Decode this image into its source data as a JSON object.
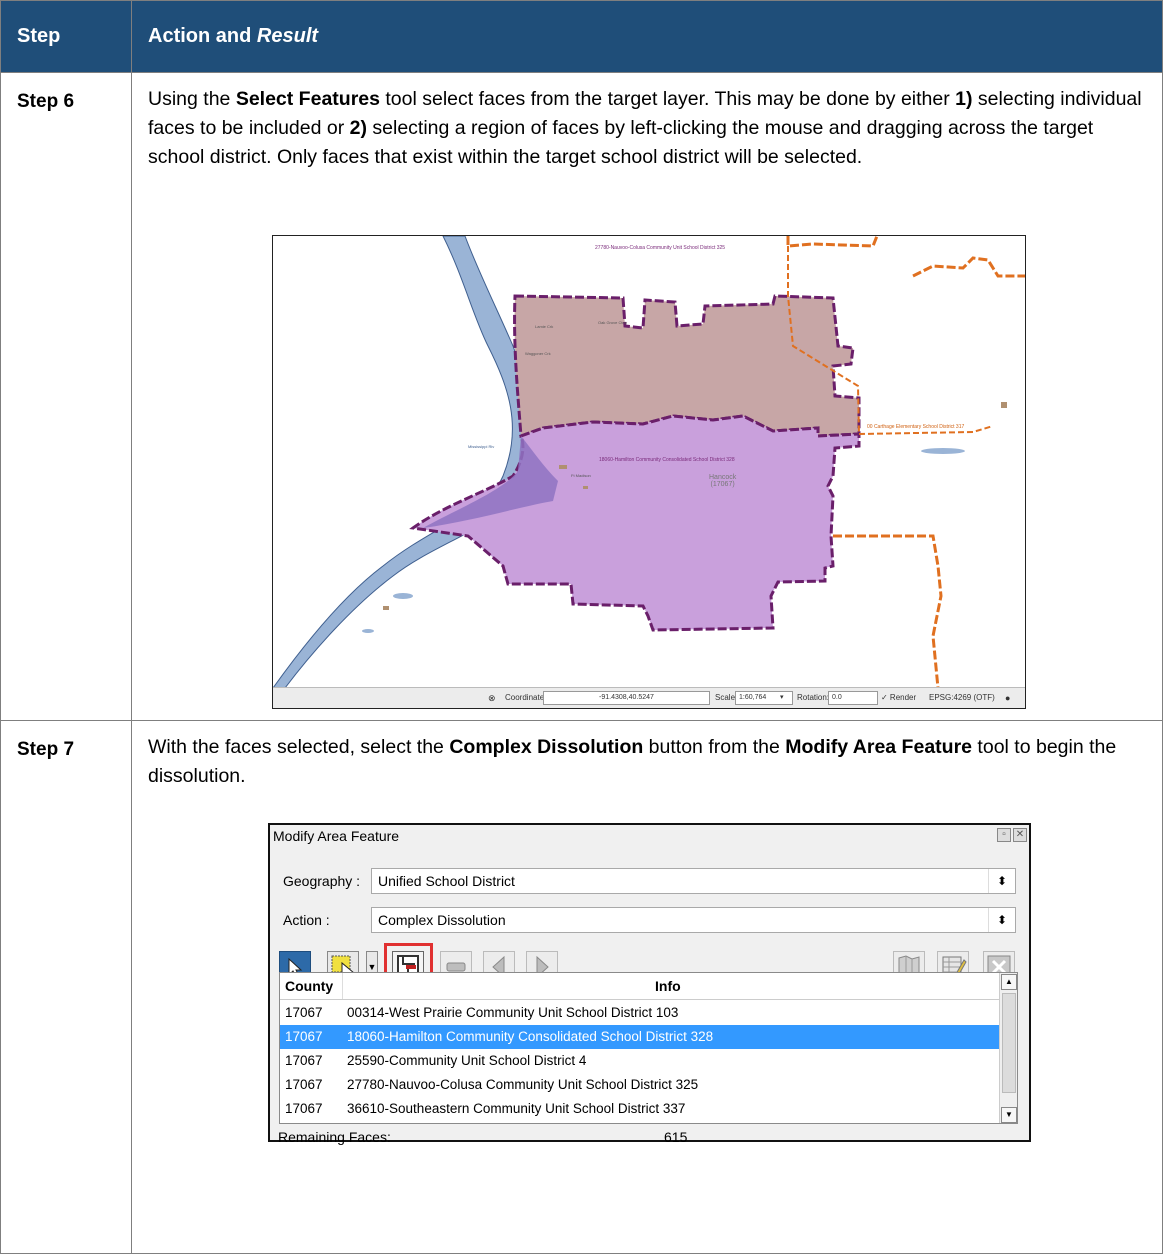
{
  "header": {
    "col_step": "Step",
    "col_action": "Action and",
    "col_result": "Result"
  },
  "step6": {
    "label": "Step 6",
    "t1": "Using the ",
    "b1": "Select Features",
    "t2": " tool select faces from the target layer. This may be done by either ",
    "b2": "1)",
    "t3": " selecting individual faces to be included or ",
    "b3": "2)",
    "t4": " selecting a region of faces by left-clicking the mouse and dragging across the target school district. Only faces that exist within the target school district will be selected.",
    "map": {
      "labels": {
        "district_top": "27780-Nauvoo-Colusa Community Unit School District 325",
        "district_main": "18060-Hamilton Community Consolidated School District 328",
        "district_right": "00 Carthage Elementary School District 317",
        "county_name": "Hancock",
        "county_code": "(17067)",
        "place_1": "Lamie Crk",
        "place_2": "Oak Grove Ctrry",
        "place_3": "Waggoner Crk",
        "place_4": "Mississippi Riv",
        "place_5": "Ft Madison"
      },
      "status": {
        "coord_label": "Coordinate:",
        "coord_value": "-91.4308,40.5247",
        "scale_label": "Scale",
        "scale_value": "1:60,764",
        "rotation_label": "Rotation:",
        "rotation_value": "0.0",
        "render_label": "✓ Render",
        "crs": "EPSG:4269 (OTF)"
      }
    }
  },
  "step7": {
    "label": "Step 7",
    "t1": "With the faces selected, select the ",
    "b1": "Complex Dissolution",
    "t2": " button from the ",
    "b2": "Modify Area Feature",
    "t3": " tool to begin the dissolution.",
    "dialog": {
      "title": "Modify Area Feature",
      "geography_label": "Geography :",
      "geography_value": "Unified School District",
      "action_label": "Action :",
      "action_value": "Complex Dissolution",
      "col_county": "County",
      "col_info": "Info",
      "rows": [
        {
          "county": "17067",
          "info": "00314-West Prairie Community Unit School District 103"
        },
        {
          "county": "17067",
          "info": "18060-Hamilton Community Consolidated School District 328"
        },
        {
          "county": "17067",
          "info": "25590-Community Unit School District 4"
        },
        {
          "county": "17067",
          "info": "27780-Nauvoo-Colusa Community Unit School District 325"
        },
        {
          "county": "17067",
          "info": "36610-Southeastern Community Unit School District 337"
        }
      ],
      "remaining_label": "Remaining Faces:",
      "remaining_value": "615"
    }
  },
  "colors": {
    "header_bg": "#1f4e79",
    "selection": "#3399ff",
    "highlight_box": "#e03030"
  }
}
